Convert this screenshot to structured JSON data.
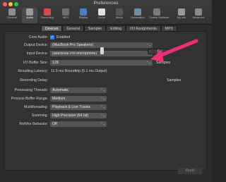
{
  "window": {
    "title": "Preferences"
  },
  "toolbar": {
    "items": [
      {
        "label": "General",
        "icon": "switch-icon",
        "color": "#8c8c8c"
      },
      {
        "label": "Audio",
        "icon": "speaker-icon",
        "color": "#9a9a9a",
        "active": true
      },
      {
        "label": "Recording",
        "icon": "record-icon",
        "color": "#d24a4a"
      },
      {
        "label": "MIDI",
        "icon": "midi-icon",
        "color": "#6f6f6f"
      },
      {
        "label": "Display",
        "icon": "display-icon",
        "color": "#4a7fc2"
      },
      {
        "label": "Score",
        "icon": "score-icon",
        "color": "#e0e0e0"
      },
      {
        "label": "Movie",
        "icon": "movie-icon",
        "color": "#555555"
      },
      {
        "label": "Automation",
        "icon": "automation-icon",
        "color": "#6c8fa8"
      },
      {
        "label": "Control Surfaces",
        "icon": "control-surfaces-icon",
        "color": "#7a7a7a"
      },
      {
        "label": "My Info",
        "icon": "person-icon",
        "color": "#9a9a9a"
      },
      {
        "label": "Advanced",
        "icon": "gear-icon",
        "color": "#8a8a8a"
      }
    ]
  },
  "tabs": [
    "Devices",
    "General",
    "Sampler",
    "Editing",
    "I/O Assignments",
    "MP3"
  ],
  "devices": {
    "core_audio_label": "Core Audio:",
    "core_audio_checkbox": "✓",
    "core_audio_value": "Enabled",
    "output_device_label": "Output Device:",
    "output_device_value": "(MacBook Pro Speakers)",
    "input_device_label": "Input Device:",
    "input_device_value": "(MacBook Pro Microphone)",
    "buffer_size_label": "I/O Buffer Size:",
    "buffer_size_value": "128",
    "buffer_size_unit": "Samples",
    "resulting_latency_label": "Resulting Latency:",
    "resulting_latency_value": "11.5 ms Roundtrip (5.1 ms Output)",
    "recording_delay_label": "Recording Delay:",
    "recording_delay_value": "0",
    "recording_delay_unit": "Samples",
    "processing_threads_label": "Processing Threads:",
    "processing_threads_value": "Automatic",
    "process_buffer_range_label": "Process Buffer Range:",
    "process_buffer_range_value": "Medium",
    "multithreading_label": "Multithreading:",
    "multithreading_value": "Playback & Live Tracks",
    "summing_label": "Summing:",
    "summing_value": "High Precision (64 bit)",
    "rewire_label": "ReWire Behavior:",
    "rewire_value": "Off"
  },
  "footer": {
    "apply_label": "Apply"
  },
  "colors": {
    "accent": "#2f7cf6",
    "annotation_arrow": "#ee2e78"
  },
  "glyphs": {
    "chevron": "⌃⌄"
  }
}
